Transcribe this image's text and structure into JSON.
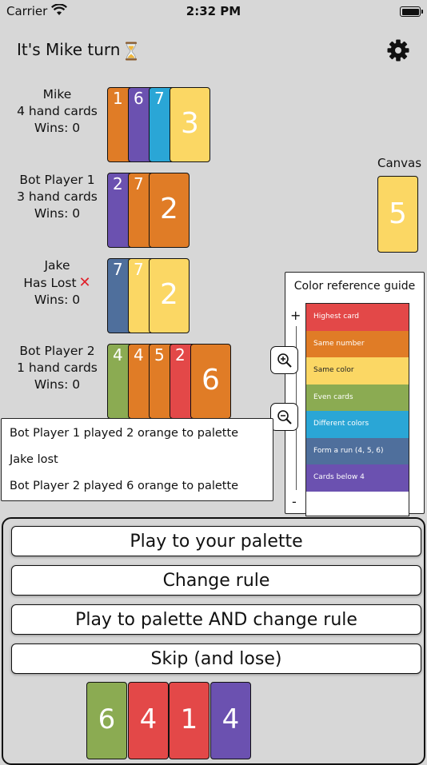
{
  "status": {
    "carrier": "Carrier",
    "time": "2:32 PM"
  },
  "header": {
    "turn_title": "It's Mike turn"
  },
  "colors": {
    "orange": "#e07c26",
    "purple": "#6b51b0",
    "blue": "#2aa6d6",
    "yellow": "#fbd764",
    "green": "#8bab52",
    "red": "#e34848",
    "slate": "#4f6f9c"
  },
  "players": [
    {
      "name": "Mike",
      "status": "4 hand cards",
      "wins": "Wins: 0",
      "cards": [
        {
          "value": "1",
          "color": "orange"
        },
        {
          "value": "6",
          "color": "purple"
        },
        {
          "value": "7",
          "color": "blue"
        },
        {
          "value": "3",
          "color": "yellow"
        }
      ]
    },
    {
      "name": "Bot Player 1",
      "status": "3 hand cards",
      "wins": "Wins: 0",
      "cards": [
        {
          "value": "2",
          "color": "purple"
        },
        {
          "value": "7",
          "color": "orange"
        },
        {
          "value": "2",
          "color": "orange"
        }
      ]
    },
    {
      "name": "Jake",
      "status": "Has Lost",
      "wins": "Wins: 0",
      "cards": [
        {
          "value": "7",
          "color": "slate"
        },
        {
          "value": "7",
          "color": "yellow"
        },
        {
          "value": "2",
          "color": "yellow"
        }
      ]
    },
    {
      "name": "Bot Player 2",
      "status": "1 hand cards",
      "wins": "Wins: 0",
      "cards": [
        {
          "value": "4",
          "color": "green"
        },
        {
          "value": "4",
          "color": "orange"
        },
        {
          "value": "5",
          "color": "orange"
        },
        {
          "value": "2",
          "color": "red"
        },
        {
          "value": "6",
          "color": "orange"
        }
      ]
    }
  ],
  "canvas": {
    "label": "Canvas",
    "value": "5",
    "color": "yellow"
  },
  "guide": {
    "title": "Color reference guide",
    "zoom_plus": "+",
    "zoom_minus": "-",
    "rules": [
      {
        "label": "Highest card",
        "color": "red"
      },
      {
        "label": "Same number",
        "color": "orange"
      },
      {
        "label": "Same color",
        "color": "yellow"
      },
      {
        "label": "Even cards",
        "color": "green"
      },
      {
        "label": "Different colors",
        "color": "blue"
      },
      {
        "label": "Form a run (4, 5, 6)",
        "color": "slate"
      },
      {
        "label": "Cards below 4",
        "color": "purple"
      }
    ]
  },
  "log": [
    "Bot Player 1 played 2 orange to palette",
    "Jake lost",
    "Bot Player 2 played 6 orange to palette"
  ],
  "actions": [
    "Play to your palette",
    "Change rule",
    "Play to palette AND change rule",
    "Skip (and lose)"
  ],
  "hand": [
    {
      "value": "6",
      "color": "green"
    },
    {
      "value": "4",
      "color": "red"
    },
    {
      "value": "1",
      "color": "red"
    },
    {
      "value": "4",
      "color": "purple"
    }
  ]
}
